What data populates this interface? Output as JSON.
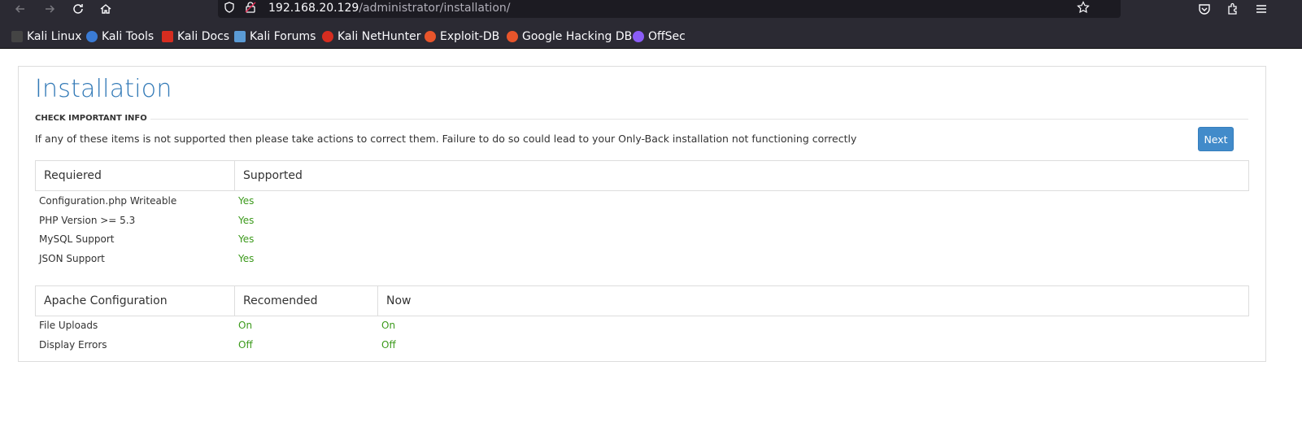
{
  "browser": {
    "url_host": "192.168.20.129",
    "url_path": "/administrator/installation/",
    "bookmarks": [
      {
        "label": "Kali Linux",
        "color": "#dddddd"
      },
      {
        "label": "Kali Tools",
        "color": "#3a7bd5"
      },
      {
        "label": "Kali Docs",
        "color": "#d62d20"
      },
      {
        "label": "Kali Forums",
        "color": "#5b9bd5"
      },
      {
        "label": "Kali NetHunter",
        "color": "#d62d20"
      },
      {
        "label": "Exploit-DB",
        "color": "#e8552b"
      },
      {
        "label": "Google Hacking DB",
        "color": "#e8552b"
      },
      {
        "label": "OffSec",
        "color": "#8a5cf6"
      }
    ]
  },
  "page": {
    "title": "Installation",
    "section_legend": "CHECK IMPORTANT INFO",
    "info_text": "If any of these items is not supported then please take actions to correct them. Failure to do so could lead to your Only-Back installation not functioning correctly",
    "next_label": "Next",
    "required_table": {
      "headers": [
        "Requiered",
        "Supported"
      ],
      "rows": [
        {
          "item": "Configuration.php Writeable",
          "status": "Yes"
        },
        {
          "item": "PHP Version >= 5.3",
          "status": "Yes"
        },
        {
          "item": "MySQL Support",
          "status": "Yes"
        },
        {
          "item": "JSON Support",
          "status": "Yes"
        }
      ]
    },
    "apache_table": {
      "headers": [
        "Apache Configuration",
        "Recomended",
        "Now"
      ],
      "rows": [
        {
          "item": "File Uploads",
          "recommended": "On",
          "now": "On"
        },
        {
          "item": "Display Errors",
          "recommended": "Off",
          "now": "Off"
        }
      ]
    }
  },
  "colors": {
    "accent": "#337ab7",
    "button": "#428bca",
    "success": "#3c9a1c"
  }
}
